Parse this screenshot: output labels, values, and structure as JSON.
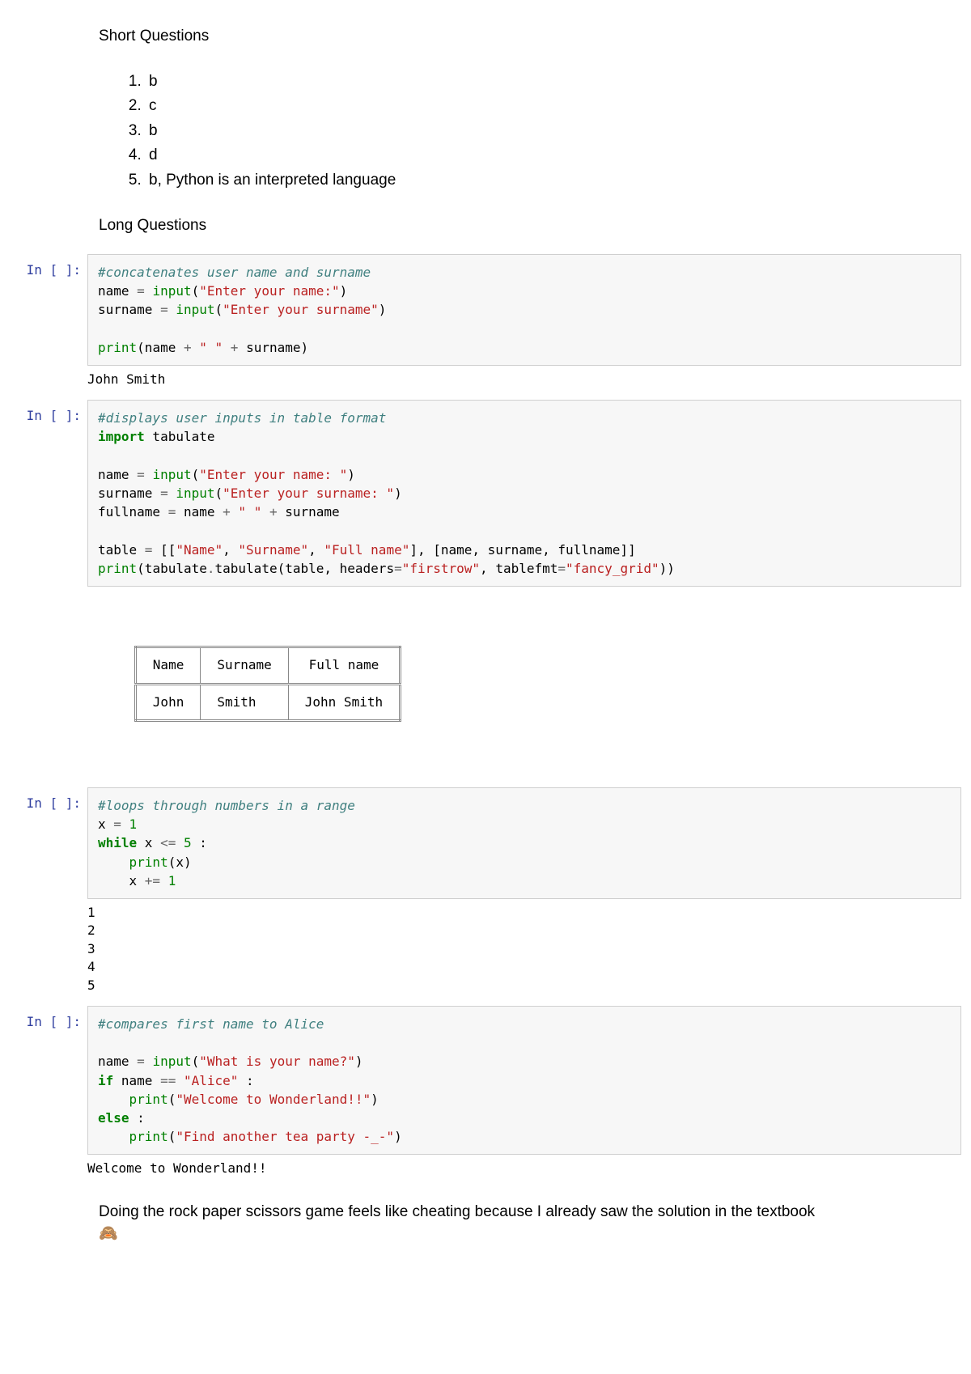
{
  "sections": {
    "short_title": "Short Questions",
    "long_title": "Long Questions"
  },
  "short_answers": [
    "b",
    "c",
    "b",
    "d",
    "b, Python is an interpreted language"
  ],
  "cells": {
    "c1": {
      "prompt": "In [ ]:",
      "code_raw": "#concatenates user name and surname\nname = input(\"Enter your name:\")\nsurname = input(\"Enter your surname\")\n\nprint(name + \" \" + surname)",
      "tokens": {
        "comment": "#concatenates user name and surname",
        "l2a": "name ",
        "l2b": "=",
        "l2c": " input",
        "l2d": "(",
        "l2e": "\"Enter your name:\"",
        "l2f": ")",
        "l3a": "surname ",
        "l3b": "=",
        "l3c": " input",
        "l3d": "(",
        "l3e": "\"Enter your surname\"",
        "l3f": ")",
        "l5a": "print",
        "l5b": "(name ",
        "l5c": "+",
        "l5d": " ",
        "l5e": "\" \"",
        "l5f": " ",
        "l5g": "+",
        "l5h": " surname)"
      },
      "output": "John Smith"
    },
    "c2": {
      "prompt": "In [ ]:",
      "tokens": {
        "comment": "#displays user inputs in table format",
        "l2a": "import",
        "l2b": " tabulate",
        "l4a": "name ",
        "l4b": "=",
        "l4c": " input",
        "l4d": "(",
        "l4e": "\"Enter your name: \"",
        "l4f": ")",
        "l5a": "surname ",
        "l5b": "=",
        "l5c": " input",
        "l5d": "(",
        "l5e": "\"Enter your surname: \"",
        "l5f": ")",
        "l6a": "fullname ",
        "l6b": "=",
        "l6c": " name ",
        "l6d": "+",
        "l6e": " ",
        "l6f": "\" \"",
        "l6g": " ",
        "l6h": "+",
        "l6i": " surname",
        "l8a": "table ",
        "l8b": "=",
        "l8c": " [[",
        "l8d": "\"Name\"",
        "l8e": ", ",
        "l8f": "\"Surname\"",
        "l8g": ", ",
        "l8h": "\"Full name\"",
        "l8i": "], [name, surname, fullname]]",
        "l9a": "print",
        "l9b": "(tabulate",
        "l9c": ".",
        "l9d": "tabulate(table, headers",
        "l9e": "=",
        "l9f": "\"firstrow\"",
        "l9g": ", tablefmt",
        "l9h": "=",
        "l9i": "\"fancy_grid\"",
        "l9j": "))"
      },
      "table": {
        "headers": [
          "Name",
          "Surname",
          "Full name"
        ],
        "row": [
          "John",
          "Smith",
          "John Smith"
        ]
      }
    },
    "c3": {
      "prompt": "In [ ]:",
      "tokens": {
        "comment": "#loops through numbers in a range",
        "l2a": "x ",
        "l2b": "=",
        "l2c": " ",
        "l2d": "1",
        "l3a": "while",
        "l3b": " x ",
        "l3c": "<=",
        "l3d": " ",
        "l3e": "5",
        "l3f": " :",
        "l4a": "    print",
        "l4b": "(x)",
        "l5a": "    x ",
        "l5b": "+=",
        "l5c": " ",
        "l5d": "1"
      },
      "output": "1\n2\n3\n4\n5"
    },
    "c4": {
      "prompt": "In [ ]:",
      "tokens": {
        "comment": "#compares first name to Alice",
        "l3a": "name ",
        "l3b": "=",
        "l3c": " input",
        "l3d": "(",
        "l3e": "\"What is your name?\"",
        "l3f": ")",
        "l4a": "if",
        "l4b": " name ",
        "l4c": "==",
        "l4d": " ",
        "l4e": "\"Alice\"",
        "l4f": " :",
        "l5a": "    print",
        "l5b": "(",
        "l5c": "\"Welcome to Wonderland!!\"",
        "l5d": ")",
        "l6a": "else",
        "l6b": " :",
        "l7a": "    print",
        "l7b": "(",
        "l7c": "\"Find another tea party -_-\"",
        "l7d": ")"
      },
      "output": "Welcome to Wonderland!!"
    }
  },
  "note": {
    "text": "Doing the rock paper scissors game feels like cheating because I already saw the solution in the textbook",
    "emoji": "🙈"
  }
}
